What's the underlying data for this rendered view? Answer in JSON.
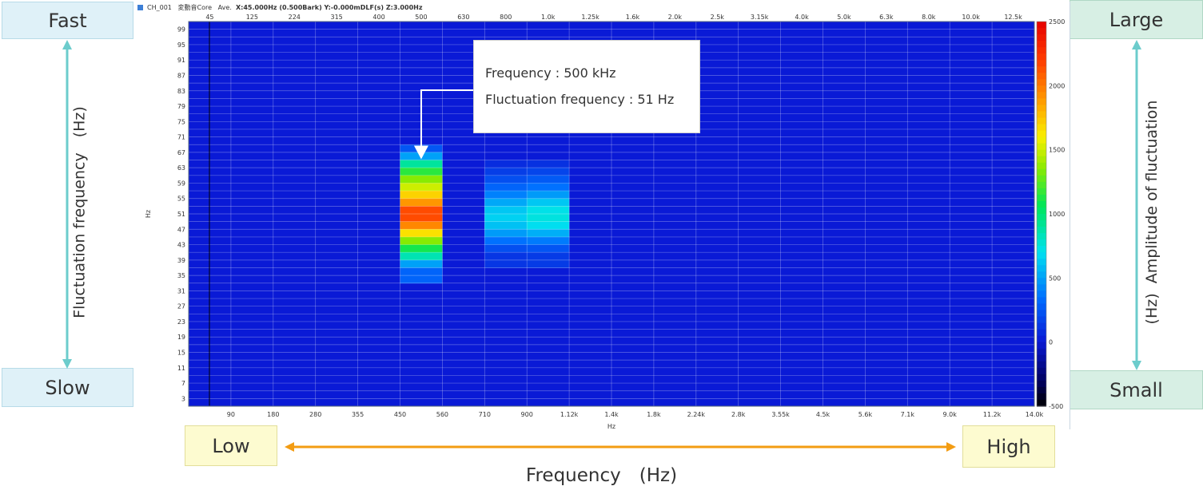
{
  "titlebar": {
    "channel": "CH_001",
    "name": "変動音Core",
    "mode": "Ave.",
    "readout": "X:45.000Hz (0.500Bark) Y:-0.000mDLF(s) Z:3.000Hz"
  },
  "labels": {
    "fast": "Fast",
    "slow": "Slow",
    "large": "Large",
    "small": "Small",
    "low": "Low",
    "high": "High",
    "left_axis": "Fluctuation frequency　(Hz)",
    "right_axis": "(Hz)  Amplitude of fluctuation",
    "bottom_axis": "Frequency　(Hz)"
  },
  "callout": {
    "line1": "Frequency : 500 kHz",
    "line2": "Fluctuation frequency : 51 Hz"
  },
  "colors": {
    "background_field": "#0a1ad6",
    "arrow_teal": "#6ccccc",
    "arrow_orange": "#f39c12"
  },
  "chart_data": {
    "type": "heatmap",
    "xlabel": "Hz",
    "ylabel": "Hz",
    "x_ticks_bottom": [
      "90",
      "180",
      "280",
      "355",
      "450",
      "560",
      "710",
      "900",
      "1.12k",
      "1.4k",
      "1.8k",
      "2.24k",
      "2.8k",
      "3.55k",
      "4.5k",
      "5.6k",
      "7.1k",
      "9.0k",
      "11.2k",
      "14.0k"
    ],
    "x_ticks_top": [
      "45",
      "125",
      "224",
      "315",
      "400",
      "500",
      "630",
      "800",
      "1.0k",
      "1.25k",
      "1.6k",
      "2.0k",
      "2.5k",
      "3.15k",
      "4.0k",
      "5.0k",
      "6.3k",
      "8.0k",
      "10.0k",
      "12.5k"
    ],
    "y_ticks": [
      "99",
      "95",
      "91",
      "87",
      "83",
      "79",
      "75",
      "71",
      "67",
      "63",
      "59",
      "55",
      "51",
      "47",
      "43",
      "39",
      "35",
      "31",
      "27",
      "23",
      "19",
      "15",
      "11",
      "7",
      "3"
    ],
    "y_range": [
      1,
      101
    ],
    "colorbar": {
      "min": -500,
      "max": 2500,
      "ticks": [
        "2500",
        "2000",
        "1500",
        "1000",
        "500",
        "0",
        "-500"
      ]
    },
    "hotspots": [
      {
        "band": "500",
        "cells": [
          {
            "y": 67,
            "value": 250
          },
          {
            "y": 65,
            "value": 500
          },
          {
            "y": 63,
            "value": 900
          },
          {
            "y": 61,
            "value": 1150
          },
          {
            "y": 59,
            "value": 1350
          },
          {
            "y": 57,
            "value": 1500
          },
          {
            "y": 55,
            "value": 1700
          },
          {
            "y": 53,
            "value": 1900
          },
          {
            "y": 51,
            "value": 2150
          },
          {
            "y": 49,
            "value": 2150
          },
          {
            "y": 47,
            "value": 1950
          },
          {
            "y": 45,
            "value": 1650
          },
          {
            "y": 43,
            "value": 1350
          },
          {
            "y": 41,
            "value": 1100
          },
          {
            "y": 39,
            "value": 850
          },
          {
            "y": 37,
            "value": 500
          },
          {
            "y": 35,
            "value": 300
          }
        ]
      },
      {
        "band": "800",
        "cells": [
          {
            "y": 63,
            "value": 80
          },
          {
            "y": 61,
            "value": 150
          },
          {
            "y": 59,
            "value": 220
          },
          {
            "y": 57,
            "value": 300
          },
          {
            "y": 55,
            "value": 400
          },
          {
            "y": 53,
            "value": 520
          },
          {
            "y": 51,
            "value": 620
          },
          {
            "y": 49,
            "value": 650
          },
          {
            "y": 47,
            "value": 600
          },
          {
            "y": 45,
            "value": 480
          },
          {
            "y": 43,
            "value": 350
          },
          {
            "y": 41,
            "value": 220
          },
          {
            "y": 39,
            "value": 120
          }
        ]
      },
      {
        "band": "1.0k",
        "cells": [
          {
            "y": 63,
            "value": 100
          },
          {
            "y": 61,
            "value": 180
          },
          {
            "y": 59,
            "value": 260
          },
          {
            "y": 57,
            "value": 350
          },
          {
            "y": 55,
            "value": 480
          },
          {
            "y": 53,
            "value": 620
          },
          {
            "y": 51,
            "value": 720
          },
          {
            "y": 49,
            "value": 740
          },
          {
            "y": 47,
            "value": 690
          },
          {
            "y": 45,
            "value": 540
          },
          {
            "y": 43,
            "value": 380
          },
          {
            "y": 41,
            "value": 240
          },
          {
            "y": 39,
            "value": 140
          }
        ]
      }
    ],
    "annotation": {
      "band": "500",
      "y": 65
    }
  }
}
